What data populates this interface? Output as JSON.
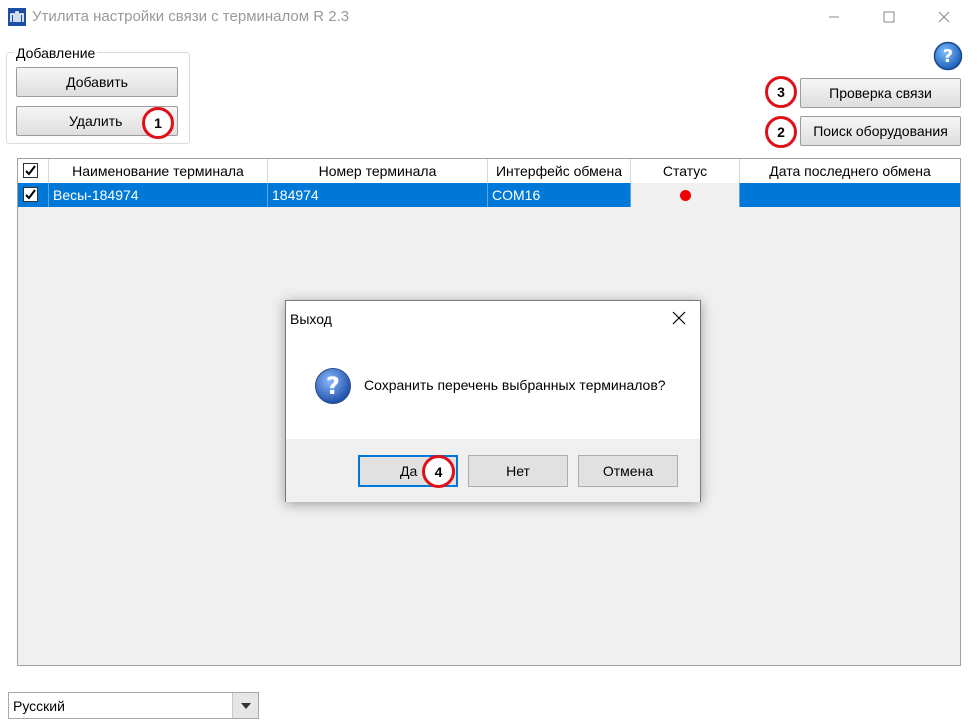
{
  "window": {
    "title": "Утилита настройки связи с терминалом R 2.3",
    "icon": "app-terminal-icon"
  },
  "group": {
    "label": "Добавление",
    "add_label": "Добавить",
    "delete_label": "Удалить"
  },
  "actions": {
    "check_label": "Проверка связи",
    "search_label": "Поиск оборудования"
  },
  "markers": {
    "m1": "1",
    "m2": "2",
    "m3": "3",
    "m4": "4"
  },
  "table": {
    "columns": [
      "Наименование терминала",
      "Номер терминала",
      "Интерфейс обмена",
      "Статус",
      "Дата последнего обмена"
    ],
    "rows": [
      {
        "checked": true,
        "name": "Весы-184974",
        "number": "184974",
        "interface": "COM16",
        "status": "red",
        "last_exchange": ""
      }
    ],
    "header_checked": true
  },
  "dialog": {
    "title": "Выход",
    "message": "Сохранить перечень выбранных терминалов?",
    "yes_label": "Да",
    "no_label": "Нет",
    "cancel_label": "Отмена"
  },
  "language": {
    "selected": "Русский"
  },
  "colors": {
    "selection": "#0078d7",
    "marker": "#e0101a",
    "status_red": "#f00000"
  }
}
